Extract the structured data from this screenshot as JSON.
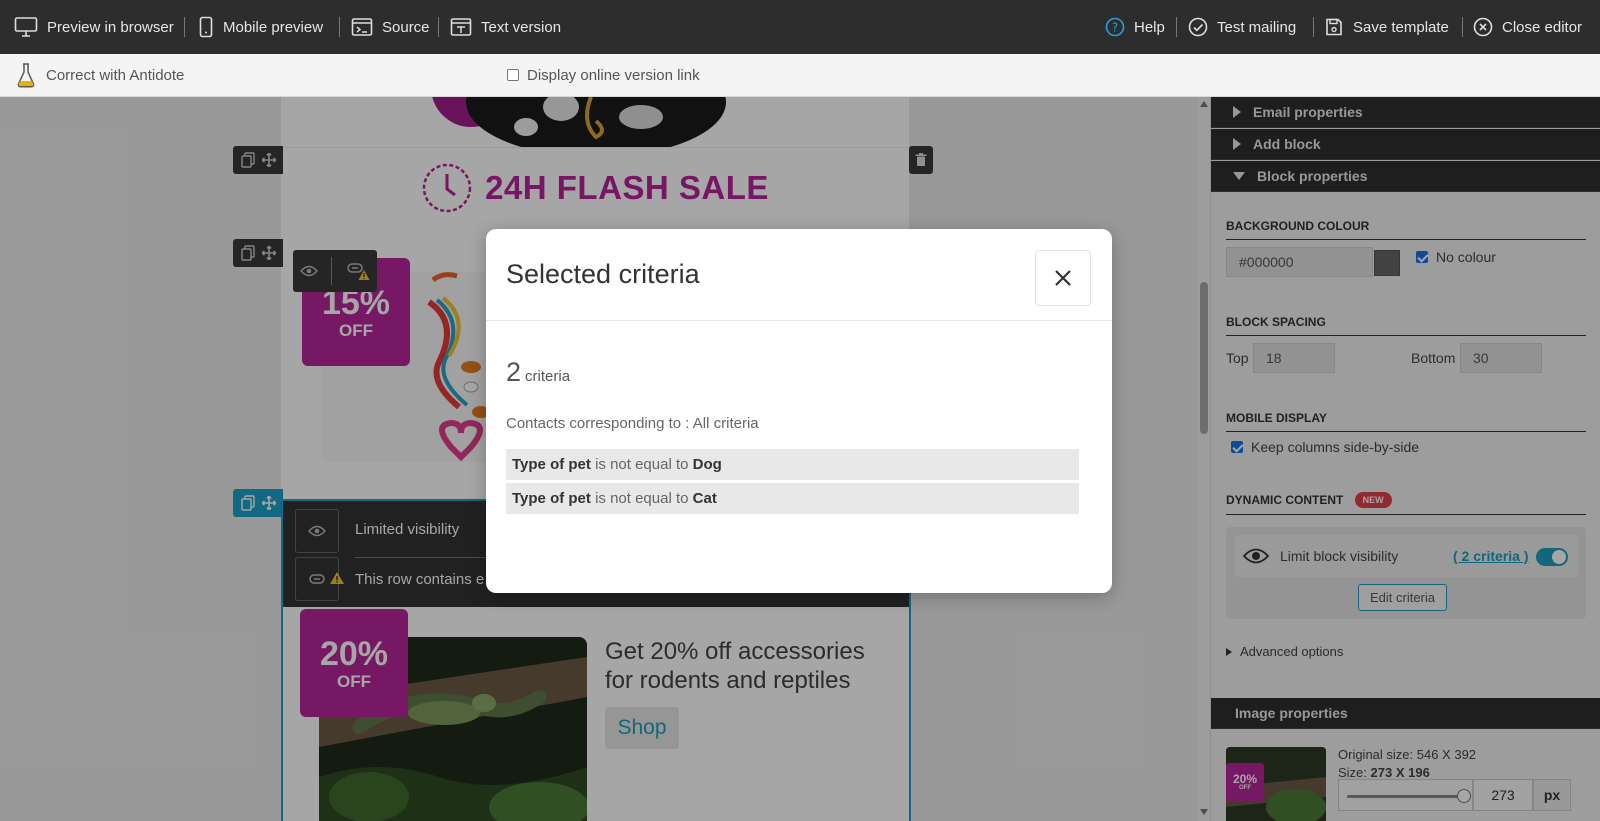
{
  "toolbar": {
    "preview_browser": "Preview in browser",
    "mobile_preview": "Mobile preview",
    "source": "Source",
    "text_version": "Text version",
    "help": "Help",
    "test_mailing": "Test mailing",
    "save_template": "Save template",
    "close_editor": "Close editor"
  },
  "subbar": {
    "antidote": "Correct with Antidote",
    "online_link": "Display online version link"
  },
  "email": {
    "flash_sale": "24H FLASH SALE",
    "badge_1_pct": "15%",
    "badge_1_off": "OFF",
    "badge_2_pct": "20%",
    "badge_2_off": "OFF",
    "limited_visibility": "Limited visibility",
    "row_warning": "This row contains e",
    "product_title": "Get 20% off accessories for rodents and reptiles",
    "shop_label": "Shop"
  },
  "panel": {
    "email_properties": "Email properties",
    "add_block": "Add block",
    "block_properties": "Block properties",
    "bg_colour_title": "BACKGROUND COLOUR",
    "bg_colour_value": "#000000",
    "no_colour": "No colour",
    "block_spacing_title": "BLOCK SPACING",
    "top_label": "Top",
    "top_value": "18",
    "bottom_label": "Bottom",
    "bottom_value": "30",
    "mobile_display_title": "MOBILE DISPLAY",
    "keep_columns": "Keep columns side-by-side",
    "dynamic_content_title": "DYNAMIC CONTENT",
    "new_badge": "NEW",
    "limit_visibility": "Limit block visibility",
    "criteria_link": "( 2 criteria )",
    "edit_criteria": "Edit criteria",
    "advanced_options": "Advanced options",
    "image_properties": "Image properties",
    "original_size": "Original size: 546 X 392",
    "size_label": "Size:",
    "size_value": "273 X 196",
    "thumb_pct": "20%",
    "thumb_off": "OFF",
    "width_value": "273",
    "unit": "px"
  },
  "modal": {
    "title": "Selected criteria",
    "count": "2",
    "count_word": "criteria",
    "contacts_line": "Contacts corresponding to : All criteria",
    "criteria": [
      {
        "field": "Type of pet",
        "op": "is not equal to",
        "value": "Dog"
      },
      {
        "field": "Type of pet",
        "op": "is not equal to",
        "value": "Cat"
      }
    ]
  },
  "colors": {
    "accent": "#1d9fbd",
    "brand_magenta": "#b7239a",
    "toolbar_bg": "#2d2d2d"
  }
}
